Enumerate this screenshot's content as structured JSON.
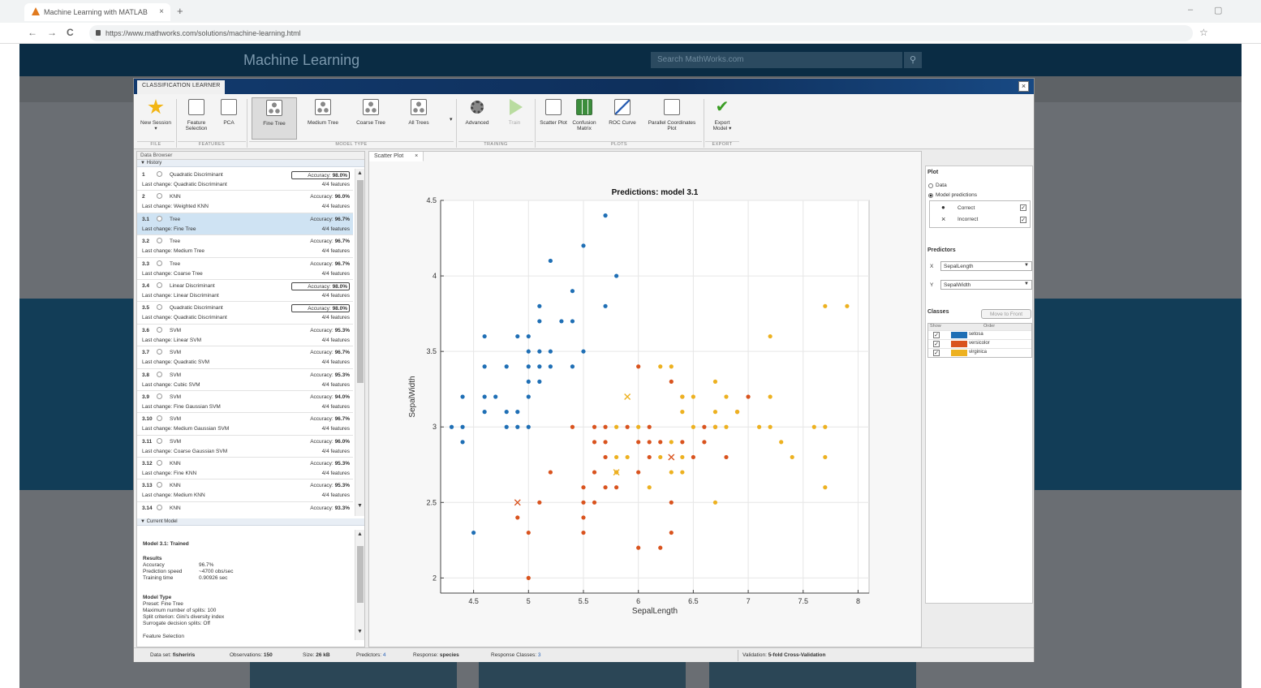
{
  "browser": {
    "tab_title": "Machine Learning with MATLAB",
    "tab_close": "×",
    "new_tab": "+",
    "url": "https://www.mathworks.com/solutions/machine-learning.html",
    "back": "←",
    "forward": "→",
    "reload": "C",
    "minimize": "–",
    "restore": "▢",
    "bookmark": "☆"
  },
  "site": {
    "title": "Machine Learning",
    "search_placeholder": "Search MathWorks.com",
    "colors": {
      "header": "#0a2c44",
      "band": "#123d57"
    }
  },
  "app": {
    "title": "CLASSIFICATION LEARNER",
    "close": "×",
    "ribbon": {
      "buttons": [
        {
          "label": "New Session ▾",
          "icon": "star-icon"
        },
        {
          "label": "Feature Selection",
          "icon": "feature-selection-icon"
        },
        {
          "label": "PCA",
          "icon": "pca-icon"
        },
        {
          "label": "Fine Tree",
          "icon": "tree-icon",
          "selected": true
        },
        {
          "label": "Medium Tree",
          "icon": "tree-icon"
        },
        {
          "label": "Coarse Tree",
          "icon": "tree-icon"
        },
        {
          "label": "All Trees",
          "icon": "tree-icon"
        },
        {
          "label": "Advanced",
          "icon": "gear-icon"
        },
        {
          "label": "Train",
          "icon": "play-icon"
        },
        {
          "label": "Scatter Plot",
          "icon": "scatter-icon"
        },
        {
          "label": "Confusion Matrix",
          "icon": "grid-icon"
        },
        {
          "label": "ROC Curve",
          "icon": "roc-icon"
        },
        {
          "label": "Parallel Coordinates Plot",
          "icon": "parallel-icon"
        },
        {
          "label": "Export Model ▾",
          "icon": "check-icon"
        }
      ],
      "more": "▾",
      "sections": [
        "FILE",
        "FEATURES",
        "MODEL TYPE",
        "TRAINING",
        "PLOTS",
        "EXPORT"
      ]
    },
    "data_browser": {
      "title": "Data Browser",
      "history_label": "▼ History",
      "current_model_label": "▼ Current Model",
      "models": [
        {
          "id": "1",
          "type": "Quadratic Discriminant",
          "last_change": "Last change: Quadratic Discriminant",
          "accuracy_label": "Accuracy:",
          "accuracy": "98.0%",
          "features": "4/4 features",
          "boxed": true
        },
        {
          "id": "2",
          "type": "KNN",
          "last_change": "Last change: Weighted KNN",
          "accuracy_label": "Accuracy:",
          "accuracy": "96.0%",
          "features": "4/4 features",
          "boxed": false
        },
        {
          "id": "3.1",
          "type": "Tree",
          "last_change": "Last change: Fine Tree",
          "accuracy_label": "Accuracy:",
          "accuracy": "96.7%",
          "features": "4/4 features",
          "boxed": false,
          "selected": true
        },
        {
          "id": "3.2",
          "type": "Tree",
          "last_change": "Last change: Medium Tree",
          "accuracy_label": "Accuracy:",
          "accuracy": "96.7%",
          "features": "4/4 features",
          "boxed": false
        },
        {
          "id": "3.3",
          "type": "Tree",
          "last_change": "Last change: Coarse Tree",
          "accuracy_label": "Accuracy:",
          "accuracy": "96.7%",
          "features": "4/4 features",
          "boxed": false
        },
        {
          "id": "3.4",
          "type": "Linear Discriminant",
          "last_change": "Last change: Linear Discriminant",
          "accuracy_label": "Accuracy:",
          "accuracy": "98.0%",
          "features": "4/4 features",
          "boxed": true
        },
        {
          "id": "3.5",
          "type": "Quadratic Discriminant",
          "last_change": "Last change: Quadratic Discriminant",
          "accuracy_label": "Accuracy:",
          "accuracy": "98.0%",
          "features": "4/4 features",
          "boxed": true
        },
        {
          "id": "3.6",
          "type": "SVM",
          "last_change": "Last change: Linear SVM",
          "accuracy_label": "Accuracy:",
          "accuracy": "95.3%",
          "features": "4/4 features",
          "boxed": false
        },
        {
          "id": "3.7",
          "type": "SVM",
          "last_change": "Last change: Quadratic SVM",
          "accuracy_label": "Accuracy:",
          "accuracy": "96.7%",
          "features": "4/4 features",
          "boxed": false
        },
        {
          "id": "3.8",
          "type": "SVM",
          "last_change": "Last change: Cubic SVM",
          "accuracy_label": "Accuracy:",
          "accuracy": "95.3%",
          "features": "4/4 features",
          "boxed": false
        },
        {
          "id": "3.9",
          "type": "SVM",
          "last_change": "Last change: Fine Gaussian SVM",
          "accuracy_label": "Accuracy:",
          "accuracy": "94.0%",
          "features": "4/4 features",
          "boxed": false
        },
        {
          "id": "3.10",
          "type": "SVM",
          "last_change": "Last change: Medium Gaussian SVM",
          "accuracy_label": "Accuracy:",
          "accuracy": "96.7%",
          "features": "4/4 features",
          "boxed": false
        },
        {
          "id": "3.11",
          "type": "SVM",
          "last_change": "Last change: Coarse Gaussian SVM",
          "accuracy_label": "Accuracy:",
          "accuracy": "96.0%",
          "features": "4/4 features",
          "boxed": false
        },
        {
          "id": "3.12",
          "type": "KNN",
          "last_change": "Last change: Fine KNN",
          "accuracy_label": "Accuracy:",
          "accuracy": "95.3%",
          "features": "4/4 features",
          "boxed": false
        },
        {
          "id": "3.13",
          "type": "KNN",
          "last_change": "Last change: Medium KNN",
          "accuracy_label": "Accuracy:",
          "accuracy": "95.3%",
          "features": "4/4 features",
          "boxed": false
        },
        {
          "id": "3.14",
          "type": "KNN",
          "last_change": "",
          "accuracy_label": "Accuracy:",
          "accuracy": "93.3%",
          "features": "",
          "boxed": false
        }
      ],
      "current_model": {
        "heading": "Model 3.1: Trained",
        "results_label": "Results",
        "accuracy_label": "Accuracy",
        "accuracy": "96.7%",
        "speed_label": "Prediction speed",
        "speed": "~4700 obs/sec",
        "time_label": "Training time",
        "time": "0.90926 sec",
        "model_type_label": "Model Type",
        "preset": "Preset: Fine Tree",
        "splits": "Maximum number of splits: 100",
        "criterion": "Split criterion: Gini's diversity index",
        "surrogate": "Surrogate decision splits: Off",
        "feature_selection": "Feature Selection"
      }
    },
    "plot_tab": {
      "label": "Scatter Plot",
      "close": "×"
    },
    "right_panel": {
      "plot_heading": "Plot",
      "data_option": "Data",
      "predictions_option": "Model predictions",
      "correct_label": "Correct",
      "incorrect_label": "Incorrect",
      "correct_marker": "●",
      "incorrect_marker": "×",
      "predictors_heading": "Predictors",
      "x_label": "X",
      "y_label": "Y",
      "x_value": "SepalLength",
      "y_value": "SepalWidth",
      "classes_heading": "Classes",
      "move_to_front": "Move to Front",
      "show_col": "Show",
      "order_col": "Order",
      "checkmark": "✓",
      "classes": [
        {
          "name": "setosa",
          "color": "#1f6fb5"
        },
        {
          "name": "versicolor",
          "color": "#d9531e"
        },
        {
          "name": "virginica",
          "color": "#edb120"
        }
      ]
    },
    "status": {
      "dataset_label": "Data set:",
      "dataset": "fisheriris",
      "observations_label": "Observations:",
      "observations": "150",
      "size_label": "Size:",
      "size": "26 kB",
      "predictors_label": "Predictors:",
      "predictors": "4",
      "response_label": "Response:",
      "response": "species",
      "response_classes_label": "Response Classes:",
      "response_classes": "3",
      "validation_label": "Validation:",
      "validation": "5-fold Cross-Validation"
    }
  },
  "chart_data": {
    "type": "scatter",
    "title": "Predictions: model 3.1",
    "xlabel": "SepalLength",
    "ylabel": "SepalWidth",
    "xlim": [
      4.2,
      8.1
    ],
    "ylim": [
      1.9,
      4.5
    ],
    "xticks": [
      4.5,
      5,
      5.5,
      6,
      6.5,
      7,
      7.5,
      8
    ],
    "yticks": [
      2,
      2.5,
      3,
      3.5,
      4,
      4.5
    ],
    "xtick_labels": [
      "4.5",
      "5",
      "5.5",
      "6",
      "6.5",
      "7",
      "7.5",
      "8"
    ],
    "ytick_labels": [
      "2",
      "2.5",
      "3",
      "3.5",
      "4",
      "4.5"
    ],
    "grid": true,
    "legend": "none",
    "series": [
      {
        "name": "setosa",
        "color": "#1f6fb5",
        "correct": [
          [
            5.7,
            4.4
          ],
          [
            5.5,
            4.2
          ],
          [
            5.2,
            4.1
          ],
          [
            5.8,
            4.0
          ],
          [
            5.4,
            3.9
          ],
          [
            5.1,
            3.8
          ],
          [
            5.7,
            3.8
          ],
          [
            5.1,
            3.7
          ],
          [
            5.3,
            3.7
          ],
          [
            5.4,
            3.7
          ],
          [
            4.6,
            3.6
          ],
          [
            4.9,
            3.6
          ],
          [
            5.0,
            3.6
          ],
          [
            5.0,
            3.5
          ],
          [
            5.1,
            3.5
          ],
          [
            5.2,
            3.5
          ],
          [
            5.5,
            3.5
          ],
          [
            4.6,
            3.4
          ],
          [
            4.8,
            3.4
          ],
          [
            5.0,
            3.4
          ],
          [
            5.1,
            3.4
          ],
          [
            5.2,
            3.4
          ],
          [
            5.4,
            3.4
          ],
          [
            5.0,
            3.3
          ],
          [
            5.1,
            3.3
          ],
          [
            4.4,
            3.2
          ],
          [
            4.6,
            3.2
          ],
          [
            4.7,
            3.2
          ],
          [
            5.0,
            3.2
          ],
          [
            4.6,
            3.1
          ],
          [
            4.8,
            3.1
          ],
          [
            4.9,
            3.1
          ],
          [
            4.3,
            3.0
          ],
          [
            4.4,
            3.0
          ],
          [
            4.8,
            3.0
          ],
          [
            4.9,
            3.0
          ],
          [
            5.0,
            3.0
          ],
          [
            4.4,
            2.9
          ],
          [
            4.5,
            2.3
          ]
        ],
        "incorrect": []
      },
      {
        "name": "versicolor",
        "color": "#d9531e",
        "correct": [
          [
            6.0,
            3.4
          ],
          [
            6.3,
            3.3
          ],
          [
            6.4,
            3.2
          ],
          [
            6.9,
            3.1
          ],
          [
            7.0,
            3.2
          ],
          [
            5.4,
            3.0
          ],
          [
            5.6,
            3.0
          ],
          [
            5.7,
            3.0
          ],
          [
            5.9,
            3.0
          ],
          [
            6.1,
            3.0
          ],
          [
            6.6,
            3.0
          ],
          [
            6.7,
            3.0
          ],
          [
            5.6,
            2.9
          ],
          [
            5.7,
            2.9
          ],
          [
            6.0,
            2.9
          ],
          [
            6.1,
            2.9
          ],
          [
            6.2,
            2.9
          ],
          [
            6.4,
            2.9
          ],
          [
            6.6,
            2.9
          ],
          [
            5.7,
            2.8
          ],
          [
            6.1,
            2.8
          ],
          [
            6.5,
            2.8
          ],
          [
            6.8,
            2.8
          ],
          [
            5.6,
            2.7
          ],
          [
            5.8,
            2.7
          ],
          [
            5.2,
            2.7
          ],
          [
            6.0,
            2.7
          ],
          [
            5.5,
            2.6
          ],
          [
            5.7,
            2.6
          ],
          [
            5.8,
            2.6
          ],
          [
            5.5,
            2.5
          ],
          [
            5.6,
            2.5
          ],
          [
            5.1,
            2.5
          ],
          [
            6.3,
            2.5
          ],
          [
            5.5,
            2.4
          ],
          [
            4.9,
            2.4
          ],
          [
            5.0,
            2.3
          ],
          [
            5.5,
            2.3
          ],
          [
            6.3,
            2.3
          ],
          [
            6.0,
            2.2
          ],
          [
            6.2,
            2.2
          ],
          [
            5.0,
            2.0
          ]
        ],
        "incorrect": [
          [
            4.9,
            2.5
          ],
          [
            6.3,
            2.8
          ]
        ]
      },
      {
        "name": "virginica",
        "color": "#edb120",
        "correct": [
          [
            7.7,
            3.8
          ],
          [
            7.9,
            3.8
          ],
          [
            7.2,
            3.6
          ],
          [
            6.2,
            3.4
          ],
          [
            6.3,
            3.4
          ],
          [
            6.7,
            3.3
          ],
          [
            6.9,
            3.1
          ],
          [
            6.8,
            3.2
          ],
          [
            7.2,
            3.2
          ],
          [
            6.5,
            3.2
          ],
          [
            6.4,
            3.1
          ],
          [
            6.7,
            3.1
          ],
          [
            6.4,
            3.2
          ],
          [
            5.8,
            3.0
          ],
          [
            6.0,
            3.0
          ],
          [
            6.5,
            3.0
          ],
          [
            6.8,
            3.0
          ],
          [
            7.1,
            3.0
          ],
          [
            7.2,
            3.0
          ],
          [
            7.6,
            3.0
          ],
          [
            7.7,
            3.0
          ],
          [
            6.7,
            3.0
          ],
          [
            6.3,
            2.9
          ],
          [
            7.3,
            2.9
          ],
          [
            5.8,
            2.8
          ],
          [
            5.9,
            2.8
          ],
          [
            6.2,
            2.8
          ],
          [
            6.4,
            2.8
          ],
          [
            7.4,
            2.8
          ],
          [
            7.7,
            2.8
          ],
          [
            5.8,
            2.7
          ],
          [
            6.3,
            2.7
          ],
          [
            6.4,
            2.7
          ],
          [
            6.1,
            2.6
          ],
          [
            7.7,
            2.6
          ],
          [
            6.7,
            2.5
          ]
        ],
        "incorrect": [
          [
            5.9,
            3.2
          ],
          [
            5.8,
            2.7
          ]
        ]
      }
    ]
  }
}
